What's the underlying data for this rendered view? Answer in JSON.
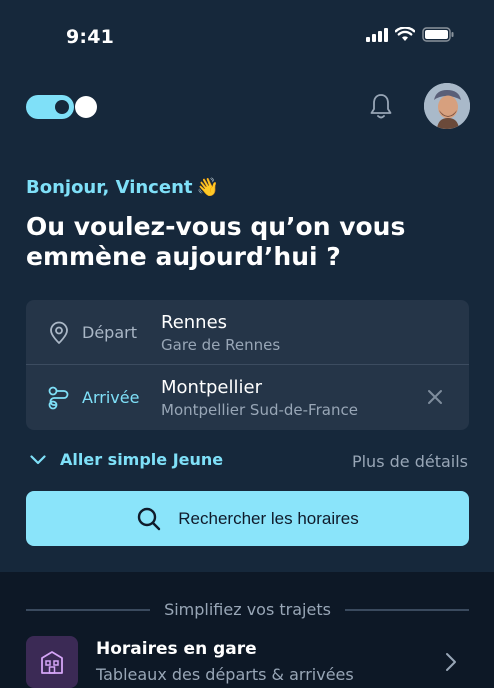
{
  "status_bar": {
    "time": "9:41"
  },
  "header": {
    "notifications_icon": "bell-icon",
    "avatar_icon": "user-avatar"
  },
  "greeting": {
    "text": "Bonjour, Vincent",
    "emoji": "👋"
  },
  "headline": "Ou voulez-vous qu’on vous emmène aujourd’hui ?",
  "search": {
    "departure": {
      "label": "Départ",
      "city": "Rennes",
      "station": "Gare de Rennes"
    },
    "arrival": {
      "label": "Arrivée",
      "city": "Montpellier",
      "station": "Montpellier Sud-de-France"
    }
  },
  "trip_type": {
    "label": "Aller simple Jeune",
    "more_details": "Plus de détails"
  },
  "search_button": {
    "label": "Rechercher les horaires"
  },
  "simplify": {
    "section_title": "Simplifiez vos trajets",
    "station_board": {
      "title": "Horaires en gare",
      "subtitle": "Tableaux des départs & arrivées"
    }
  },
  "colors": {
    "accent": "#7fe0f8",
    "button": "#8ae4fa",
    "background": "#16283b",
    "card": "#253548"
  }
}
